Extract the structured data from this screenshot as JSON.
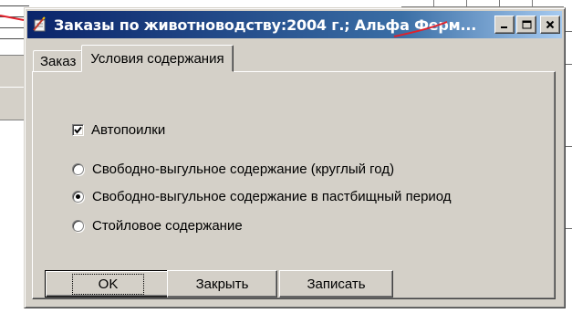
{
  "window": {
    "title": "Заказы по животноводству:2004 г.; Альфа Ферм...",
    "app_icon": "edit-document-icon",
    "minimize_icon": "minimize-icon",
    "maximize_icon": "maximize-icon",
    "close_icon": "close-icon"
  },
  "tabs": [
    {
      "label": "Заказ",
      "active": false
    },
    {
      "label": "Условия содержания",
      "active": true
    }
  ],
  "form": {
    "autopoilki": {
      "label": "Автопоилки",
      "checked": true
    },
    "housing_options": [
      {
        "label": "Свободно-выгульное содержание (круглый год)",
        "selected": false
      },
      {
        "label": "Свободно-выгульное содержание в пастбищный период",
        "selected": true
      },
      {
        "label": "Стойловое содержание",
        "selected": false
      }
    ]
  },
  "buttons": {
    "ok": "OK",
    "close": "Закрыть",
    "save": "Записать"
  },
  "colors": {
    "face": "#d4d0c8",
    "title_start": "#0a246a",
    "title_end": "#a6caf0",
    "annotation": "#e0202a"
  }
}
